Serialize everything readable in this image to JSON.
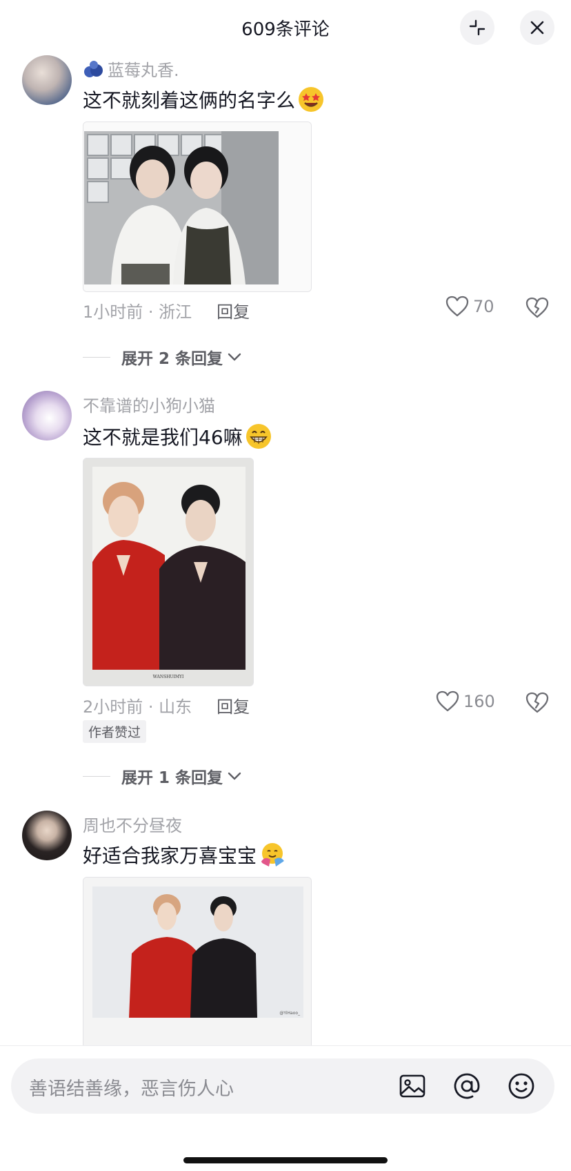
{
  "header": {
    "title": "609条评论"
  },
  "comments": [
    {
      "username": "蓝莓丸香.",
      "text": "这不就刻着这俩的名字么",
      "time_location": "1小时前 · 浙江",
      "reply": "回复",
      "likes": "70",
      "expand": "展开 2 条回复"
    },
    {
      "username": "不靠谱的小狗小猫",
      "text": "这不就是我们46嘛",
      "time_location": "2小时前 · 山东",
      "reply": "回复",
      "likes": "160",
      "badge": "作者赞过",
      "expand": "展开 1 条回复",
      "photo_caption": "WANSHUIMYI"
    },
    {
      "username": "周也不分昼夜",
      "text": "好适合我家万喜宝宝",
      "photo_caption": "@YiHaoo_"
    }
  ],
  "input": {
    "placeholder": "善语结善缘，恶言伤人心"
  },
  "colors": {
    "text": "#161823",
    "muted": "#a2a3a8",
    "red_outfit": "#c4221c"
  },
  "icons": [
    "shrink-icon",
    "close-icon",
    "blueberry-icon",
    "heart-icon",
    "broken-heart-icon",
    "image-icon",
    "at-icon",
    "smile-icon",
    "star-eyes-emoji",
    "grin-emoji",
    "hug-emoji"
  ]
}
